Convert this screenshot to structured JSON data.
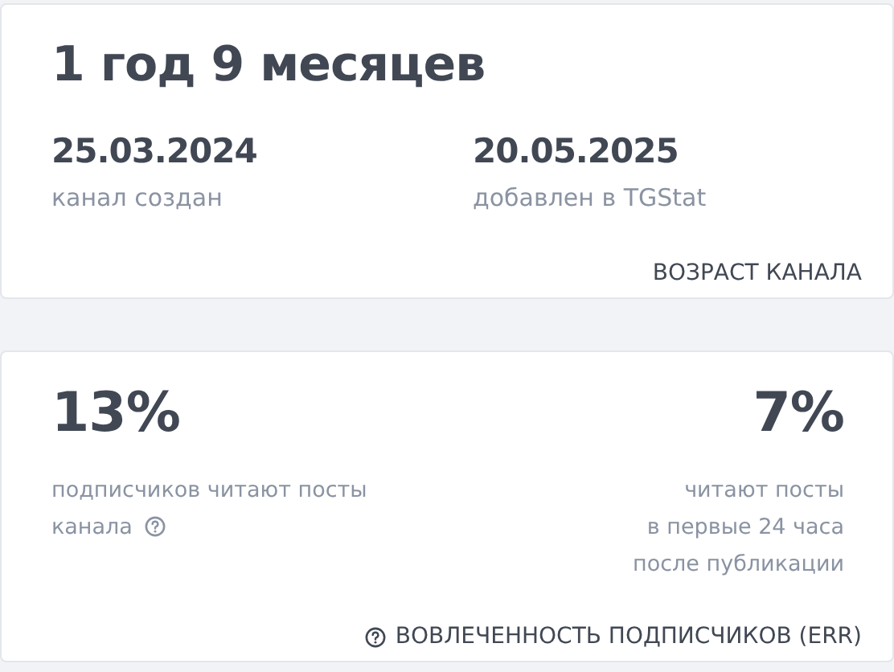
{
  "age_card": {
    "headline": "1 год 9 месяцев",
    "dates": [
      {
        "value": "25.03.2024",
        "caption": "канал создан"
      },
      {
        "value": "20.05.2025",
        "caption": "добавлен в TGStat"
      }
    ],
    "footer": "ВОЗРАСТ КАНАЛА"
  },
  "engagement_card": {
    "metrics": [
      {
        "value": "13%",
        "description": [
          "подписчиков читают посты",
          "канала"
        ],
        "help": true
      },
      {
        "value": "7%",
        "description": [
          "читают посты",
          "в первые 24 часа",
          "после публикации"
        ],
        "help": false
      }
    ],
    "footer": "ВОВЛЕЧЕННОСТЬ ПОДПИСЧИКОВ (ERR)"
  }
}
